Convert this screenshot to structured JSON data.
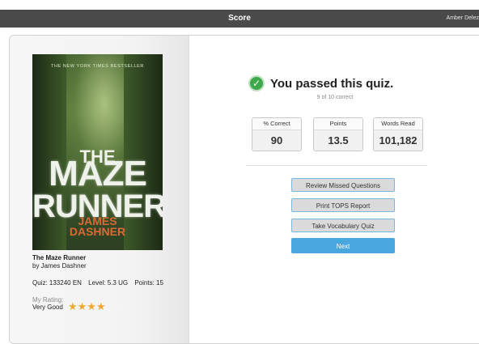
{
  "header": {
    "title": "Score",
    "user_name": "Amber Delez"
  },
  "book": {
    "cover": {
      "tagline": "THE NEW YORK TIMES BESTSELLER",
      "title_line1": "THE",
      "title_line2": "MAZE",
      "title_line3": "RUNNER",
      "author_line1": "JAMES",
      "author_line2": "DASHNER"
    },
    "title": "The Maze Runner",
    "byline": "by James Dashner",
    "quiz": "Quiz: 133240 EN",
    "level": "Level: 5.3 UG",
    "points": "Points: 15",
    "rating_label": "My Rating:",
    "rating_value": "Very Good",
    "rating_stars": 4,
    "star_glyphs": "★★★★"
  },
  "result": {
    "message": "You passed this quiz.",
    "subtext": "9 of 10 correct",
    "stats": [
      {
        "label": "% Correct",
        "value": "90"
      },
      {
        "label": "Points",
        "value": "13.5"
      },
      {
        "label": "Words Read",
        "value": "101,182"
      }
    ]
  },
  "actions": {
    "review": "Review Missed Questions",
    "print": "Print TOPS Report",
    "vocab": "Take Vocabulary Quiz",
    "next": "Next"
  },
  "colors": {
    "topbar": "#4a4a4a",
    "success": "#3ea84a",
    "primary_button": "#4aa6df",
    "star": "#f0a830"
  }
}
